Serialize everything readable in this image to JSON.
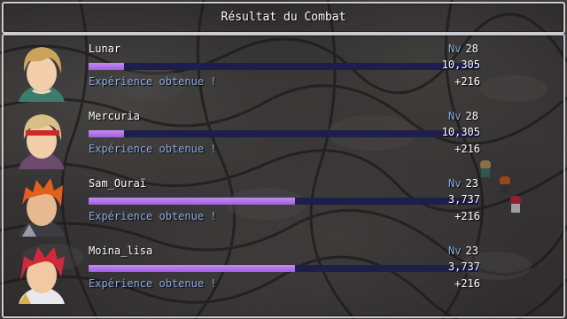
{
  "title": "Résultat du Combat",
  "level_label": "Nv",
  "experience_label": "Expérience obtenue !",
  "colors": {
    "system_blue": "#88aadd",
    "exp_bar": "#a05fe0",
    "bar_track": "#1e1e4a"
  },
  "party": [
    {
      "name": "Lunar",
      "level": "28",
      "exp_total": "10,305",
      "exp_progress": 0.09,
      "exp_gained": "+216",
      "portrait": "blond-hero-portrait",
      "colors": {
        "hair": "#c9a45a",
        "cloth": "#3f7a6e",
        "skin": "#f2cfaa",
        "accent": "#e8d9b0"
      }
    },
    {
      "name": "Mercuria",
      "level": "28",
      "exp_total": "10,305",
      "exp_progress": 0.09,
      "exp_gained": "+216",
      "portrait": "blond-headband-portrait",
      "colors": {
        "hair": "#d8bf86",
        "cloth": "#6b4a6e",
        "skin": "#f2cfaa",
        "accent": "#cc2a2a"
      }
    },
    {
      "name": "Sam_Ouraï",
      "level": "23",
      "exp_total": "3,737",
      "exp_progress": 0.53,
      "exp_gained": "+216",
      "portrait": "orange-hair-warrior-portrait",
      "colors": {
        "hair": "#e0601e",
        "cloth": "#3c3c44",
        "skin": "#e8b890",
        "accent": "#9a9aa8"
      }
    },
    {
      "name": "Moina_lisa",
      "level": "23",
      "exp_total": "3,737",
      "exp_progress": 0.53,
      "exp_gained": "+216",
      "portrait": "red-hair-warrior-portrait",
      "colors": {
        "hair": "#d2283c",
        "cloth": "#e8e8ee",
        "skin": "#f0c8a2",
        "accent": "#d8b048"
      }
    }
  ]
}
